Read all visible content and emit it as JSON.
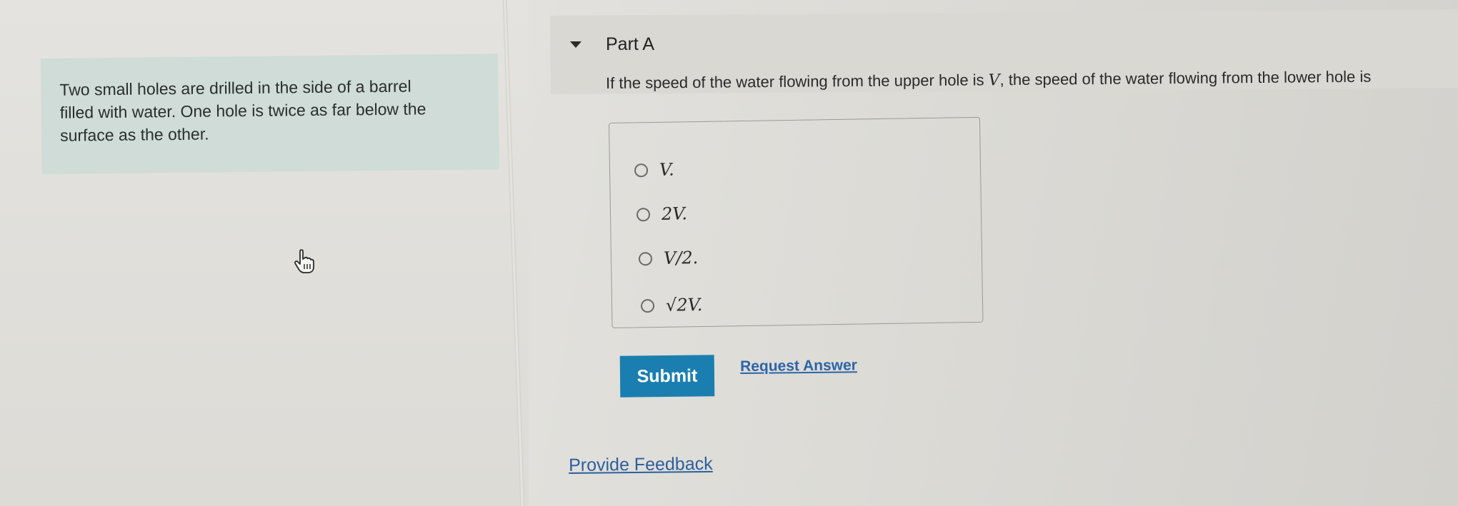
{
  "intro": {
    "line1": "Two small holes are drilled in the side of a barrel",
    "line2": "filled with water. One hole is twice as far below the",
    "line3": "surface as the other."
  },
  "part": {
    "title": "Part A"
  },
  "question": {
    "text_before": "If the speed of the water flowing from the upper hole is ",
    "variable": "V",
    "text_after": ", the speed of the water flowing from the lower hole is"
  },
  "options": [
    {
      "label": "V."
    },
    {
      "label": "2V."
    },
    {
      "label": "V/2."
    },
    {
      "label": "√2V."
    }
  ],
  "actions": {
    "submit_label": "Submit",
    "request_answer_label": "Request Answer"
  },
  "footer": {
    "feedback_label": "Provide Feedback"
  },
  "colors": {
    "accent": "#1a7fb0",
    "link": "#2d64a8",
    "intro_bg": "#cfdcd7"
  }
}
